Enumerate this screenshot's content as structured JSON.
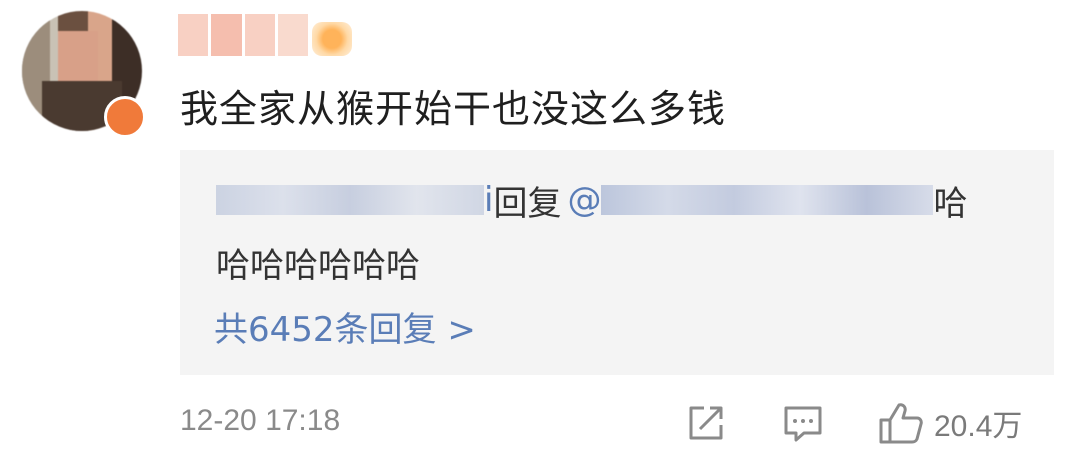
{
  "comment": {
    "text": "我全家从猴开始干也没这么多钱"
  },
  "reply": {
    "user_suffix": "i",
    "reply_word": "回复",
    "mention_prefix": "@",
    "text_tail": "哈",
    "text_line2": "哈哈哈哈哈哈",
    "more_label": "共6452条回复 >"
  },
  "meta": {
    "time": "12-20 17:18",
    "like_count": "20.4万"
  },
  "icons": {
    "share": "share-icon",
    "comment": "comment-icon",
    "like": "thumbs-up-icon"
  },
  "colors": {
    "link": "#5a7db7",
    "reply_bg": "#f4f4f4",
    "meta_text": "#8a8a8a"
  }
}
